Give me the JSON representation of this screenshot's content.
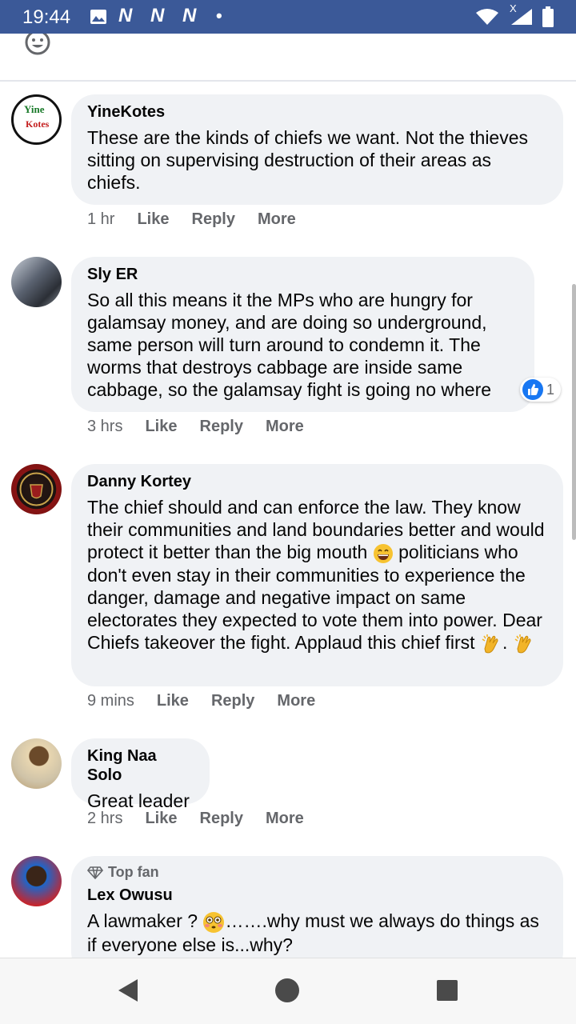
{
  "status_bar": {
    "time": "19:44",
    "notification_letters": [
      "N",
      "N",
      "N"
    ],
    "dot": "•",
    "network_badge": "X"
  },
  "comments": [
    {
      "name": "YineKotes",
      "avatar_text_top": "Yine",
      "avatar_text_bottom": "Kotes",
      "text": "These are the kinds of chiefs we want. Not the thieves sitting on supervising destruction of their areas as chiefs.",
      "time": "1 hr",
      "like": "Like",
      "reply": "Reply",
      "more": "More"
    },
    {
      "name": "Sly ER",
      "text": "So all this means it the MPs who are hungry for galamsay money, and are doing so underground, same person will turn around to condemn it. The worms that destroys cabbage are inside same cabbage, so the galamsay fight is going no where",
      "time": "3 hrs",
      "like": "Like",
      "reply": "Reply",
      "more": "More",
      "reaction_count": "1"
    },
    {
      "name": "Danny Kortey",
      "text_parts": [
        "The chief should and can enforce the law. They know their communities and land boundaries better and would protect it better than the big mouth ",
        " politicians who don't even stay in their communities to experience the danger, damage and negative impact on same electorates they expected to vote them into power. Dear Chiefs takeover the fight. Applaud this chief first ",
        ". "
      ],
      "time": "9 mins",
      "like": "Like",
      "reply": "Reply",
      "more": "More"
    },
    {
      "name": "King Naa Solo",
      "text": "Great leader",
      "time": "2 hrs",
      "like": "Like",
      "reply": "Reply",
      "more": "More"
    },
    {
      "badge": "Top fan",
      "name": "Lex Owusu",
      "text_parts": [
        "A lawmaker ? ",
        "…….why must we always do things as if everyone else is...why?"
      ]
    }
  ],
  "colors": {
    "status_bar": "#3b5998",
    "bubble": "#f0f2f5",
    "meta_text": "#65676b",
    "like_blue": "#1877f2"
  }
}
